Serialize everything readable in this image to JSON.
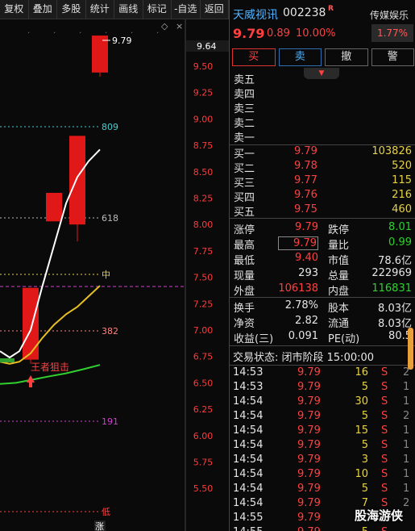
{
  "toolbar": [
    "复权",
    "叠加",
    "多股",
    "统计",
    "画线",
    "标记",
    "-自选",
    "返回"
  ],
  "chart": {
    "y_axis_labels": [
      "9.50",
      "9.25",
      "9.00",
      "8.75",
      "8.50",
      "8.25",
      "8.00",
      "7.75",
      "7.50",
      "7.25",
      "7.00",
      "6.75",
      "6.50",
      "6.25",
      "6.00",
      "5.75",
      "5.50"
    ],
    "current_price_tag": "9.64",
    "high_label": "9.79",
    "fib_levels": [
      {
        "label": "809",
        "color": "#44d0d0"
      },
      {
        "label": "618",
        "color": "#bbbbbb"
      },
      {
        "label": "中",
        "color": "#e6d24a"
      },
      {
        "label": "382",
        "color": "#ff8080"
      },
      {
        "label": "191",
        "color": "#d040d0"
      },
      {
        "label": "低",
        "color": "#ff4040"
      }
    ],
    "signal_text": "王者狙击",
    "bottom_mark": "涨",
    "colors": {
      "up": "#e01818",
      "ma_white": "#ffffff",
      "ma_yellow": "#e6c020",
      "ma_green": "#30d030"
    }
  },
  "panel": {
    "stock_name": "天威视讯",
    "stock_code": "002238",
    "r_mark": "R",
    "sector": "传媒娱乐",
    "price": "9.79",
    "change": "0.89",
    "change_pct": "10.00%",
    "sector_change": "1.77%",
    "actions": [
      "买",
      "卖",
      "撤",
      "警"
    ],
    "collapse_icon": "chevron-down-icon",
    "asks": [
      {
        "label": "卖五",
        "price": "",
        "vol": ""
      },
      {
        "label": "卖四",
        "price": "",
        "vol": ""
      },
      {
        "label": "卖三",
        "price": "",
        "vol": ""
      },
      {
        "label": "卖二",
        "price": "",
        "vol": ""
      },
      {
        "label": "卖一",
        "price": "",
        "vol": ""
      }
    ],
    "bids": [
      {
        "label": "买一",
        "price": "9.79",
        "vol": "103826"
      },
      {
        "label": "买二",
        "price": "9.78",
        "vol": "520"
      },
      {
        "label": "买三",
        "price": "9.77",
        "vol": "115"
      },
      {
        "label": "买四",
        "price": "9.76",
        "vol": "216"
      },
      {
        "label": "买五",
        "price": "9.75",
        "vol": "460"
      }
    ],
    "quote1": [
      {
        "l": "涨停",
        "lv": "9.79",
        "lc": "red",
        "r": "跌停",
        "rv": "8.01",
        "rc": "green"
      },
      {
        "l": "最高",
        "lv": "9.79",
        "lc": "red box",
        "r": "量比",
        "rv": "0.99",
        "rc": "green"
      },
      {
        "l": "最低",
        "lv": "9.40",
        "lc": "red",
        "r": "市值",
        "rv": "78.6亿",
        "rc": "white"
      },
      {
        "l": "现量",
        "lv": "293",
        "lc": "white",
        "r": "总量",
        "rv": "222969",
        "rc": "white"
      },
      {
        "l": "外盘",
        "lv": "106138",
        "lc": "red",
        "r": "内盘",
        "rv": "116831",
        "rc": "green"
      }
    ],
    "quote2": [
      {
        "l": "换手",
        "lv": "2.78%",
        "lc": "white",
        "r": "股本",
        "rv": "8.03亿",
        "rc": "white"
      },
      {
        "l": "净资",
        "lv": "2.82",
        "lc": "white",
        "r": "流通",
        "rv": "8.03亿",
        "rc": "white"
      },
      {
        "l": "收益(三)",
        "lv": "0.091",
        "lc": "white",
        "r": "PE(动)",
        "rv": "80.5",
        "rc": "white"
      }
    ],
    "status": "交易状态: 闭市阶段 15:00:00",
    "ticks": [
      {
        "time": "14:53",
        "price": "9.79",
        "vol": "16",
        "side": "S",
        "extra": "2"
      },
      {
        "time": "14:53",
        "price": "9.79",
        "vol": "5",
        "side": "S",
        "extra": "1"
      },
      {
        "time": "14:54",
        "price": "9.79",
        "vol": "30",
        "side": "S",
        "extra": "1"
      },
      {
        "time": "14:54",
        "price": "9.79",
        "vol": "5",
        "side": "S",
        "extra": "2"
      },
      {
        "time": "14:54",
        "price": "9.79",
        "vol": "15",
        "side": "S",
        "extra": "1"
      },
      {
        "time": "14:54",
        "price": "9.79",
        "vol": "5",
        "side": "S",
        "extra": "1"
      },
      {
        "time": "14:54",
        "price": "9.79",
        "vol": "3",
        "side": "S",
        "extra": "1"
      },
      {
        "time": "14:54",
        "price": "9.79",
        "vol": "10",
        "side": "S",
        "extra": "1"
      },
      {
        "time": "14:54",
        "price": "9.79",
        "vol": "5",
        "side": "S",
        "extra": "1"
      },
      {
        "time": "14:54",
        "price": "9.79",
        "vol": "7",
        "side": "S",
        "extra": "2"
      },
      {
        "time": "14:55",
        "price": "9.79",
        "vol": "",
        "side": "",
        "extra": ""
      },
      {
        "time": "14:55",
        "price": "9.79",
        "vol": "5",
        "side": "S",
        "extra": ""
      }
    ],
    "watermark": "股海游侠"
  }
}
